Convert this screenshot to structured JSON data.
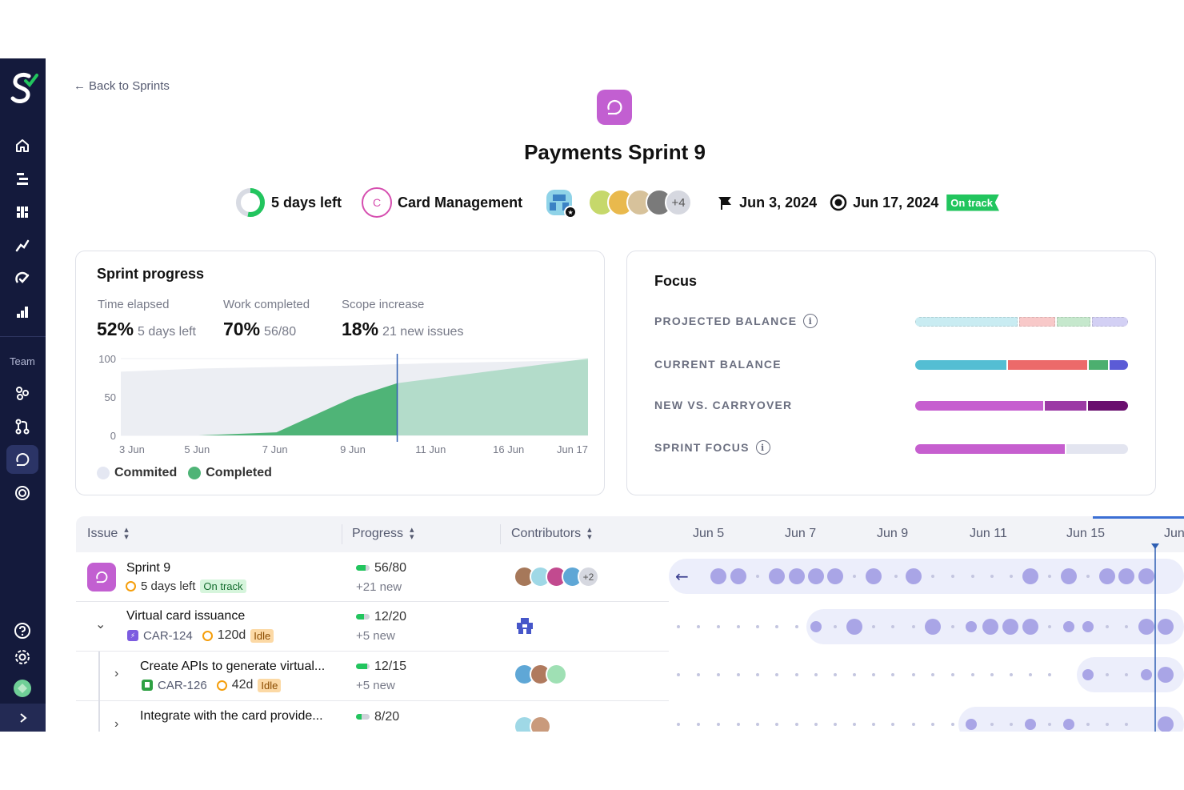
{
  "nav": {
    "back_label": "Back to Sprints",
    "team_label": "Team"
  },
  "sprint": {
    "title": "Payments Sprint 9",
    "days_left": "5 days left",
    "project_letter": "C",
    "project_name": "Card Management",
    "contributors_more": "+4",
    "start_date": "Jun 3, 2024",
    "end_date": "Jun 17, 2024",
    "status": "On track"
  },
  "progress_card": {
    "title": "Sprint progress",
    "stats": [
      {
        "label": "Time elapsed",
        "value": "52%",
        "sub": "5 days left"
      },
      {
        "label": "Work completed",
        "value": "70%",
        "sub": "56/80"
      },
      {
        "label": "Scope increase",
        "value": "18%",
        "sub": "21 new issues"
      }
    ],
    "legend": [
      {
        "label": "Commited",
        "color": "#e4e7f2"
      },
      {
        "label": "Completed",
        "color": "#4fb477"
      }
    ]
  },
  "chart_data": {
    "type": "area",
    "x": [
      "3 Jun",
      "5 Jun",
      "7 Jun",
      "9 Jun",
      "11 Jun",
      "16 Jun",
      "Jun 17"
    ],
    "ylim": [
      0,
      100
    ],
    "yticks": [
      0,
      50,
      100
    ],
    "today_index": 3.55,
    "series": [
      {
        "name": "Commited",
        "color": "#eceef3",
        "values": [
          83,
          87,
          89,
          91,
          94,
          96,
          98
        ]
      },
      {
        "name": "Completed",
        "color": "#4fb477",
        "values": [
          0,
          0,
          4,
          50,
          60,
          62,
          68
        ]
      }
    ],
    "projection": {
      "color": "#6ec59a",
      "from": 68,
      "to": 100
    },
    "grid": true
  },
  "focus_card": {
    "title": "Focus",
    "rows": [
      {
        "label": "PROJECTED BALANCE",
        "info": true,
        "segments": [
          {
            "value": 50,
            "color": "#c9ecf2"
          },
          {
            "value": 17,
            "color": "#f8c9c9"
          },
          {
            "value": 16,
            "color": "#c6e8cd"
          },
          {
            "value": 17,
            "color": "#d3d0f4"
          }
        ]
      },
      {
        "label": "CURRENT BALANCE",
        "info": false,
        "segments": [
          {
            "value": 44,
            "color": "#54bed3"
          },
          {
            "value": 38,
            "color": "#ec6a6a"
          },
          {
            "value": 9,
            "color": "#4caf6f"
          },
          {
            "value": 9,
            "color": "#5b5bd6"
          }
        ]
      },
      {
        "label": "NEW VS. CARRYOVER",
        "info": false,
        "segments": [
          {
            "value": 61,
            "color": "#c65fcf"
          },
          {
            "value": 20,
            "color": "#9c3aa5"
          },
          {
            "value": 19,
            "color": "#6a0f6e"
          }
        ]
      },
      {
        "label": "SPRINT FOCUS",
        "info": true,
        "segments": [
          {
            "value": 71,
            "color": "#c65fcf"
          },
          {
            "value": 29,
            "color": "#e3e5f0"
          }
        ]
      }
    ]
  },
  "table": {
    "columns": [
      "Issue",
      "Progress",
      "Contributors"
    ],
    "rows": [
      {
        "title": "Sprint 9",
        "sub_text": "5 days left",
        "badge": "On track",
        "progress": "56/80",
        "progress_new": "+21 new",
        "contributors_more": "+2",
        "fill": 0.7
      },
      {
        "title": "Virtual card issuance",
        "key": "CAR-124",
        "age": "120d",
        "badge": "Idle",
        "progress": "12/20",
        "progress_new": "+5 new",
        "fill": 0.6
      },
      {
        "title": "Create APIs to generate virtual...",
        "key": "CAR-126",
        "age": "42d",
        "badge": "Idle",
        "progress": "12/15",
        "progress_new": "+5 new",
        "fill": 0.8
      },
      {
        "title": "Integrate with the card provide...",
        "progress": "8/20",
        "fill": 0.4
      }
    ]
  },
  "timeline": {
    "dates": [
      "Jun 5",
      "Jun 7",
      "Jun 9",
      "Jun 11",
      "Jun 15",
      "Jun"
    ]
  },
  "colors": {
    "sidebar": "#141a3c",
    "accent_purple": "#c25fd1",
    "on_track": "#22c55e",
    "timeline_dot": "#a9a5e6"
  }
}
